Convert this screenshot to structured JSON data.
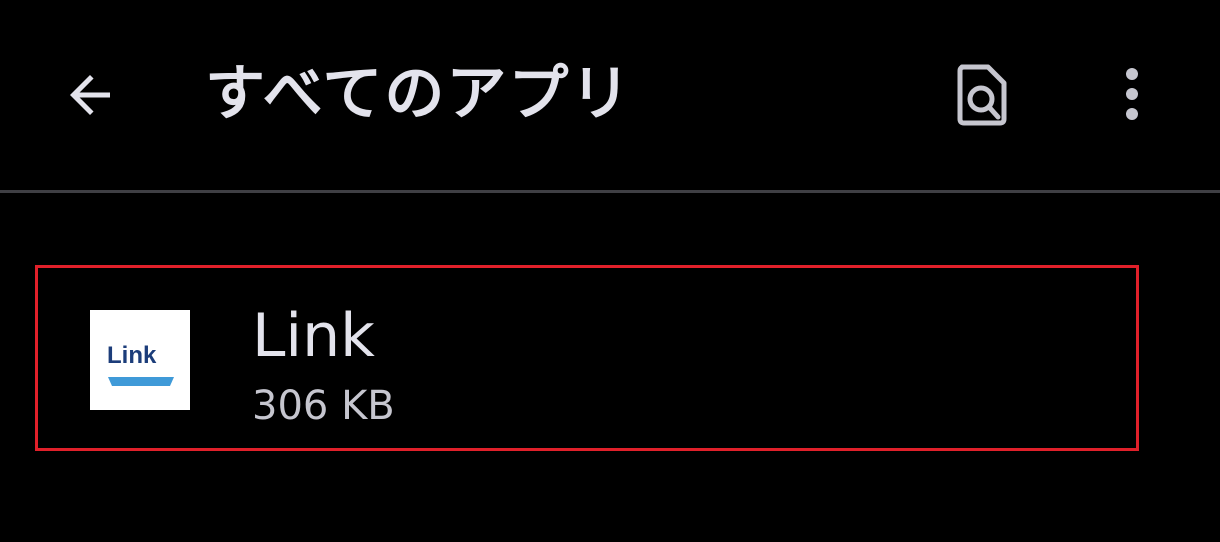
{
  "header": {
    "title": "すべてのアプリ",
    "back_icon": "arrow-back-icon",
    "search_icon": "find-in-page-icon",
    "more_icon": "more-vert-icon"
  },
  "apps": [
    {
      "name": "Link",
      "size": "306 KB",
      "icon_text": "Link",
      "icon_color": "#1c3d7a",
      "icon_accent": "#3f9ad8"
    }
  ],
  "colors": {
    "background": "#000000",
    "text": "#e3e3ec",
    "highlight_border": "#e0202a",
    "divider": "#3f3f44"
  }
}
